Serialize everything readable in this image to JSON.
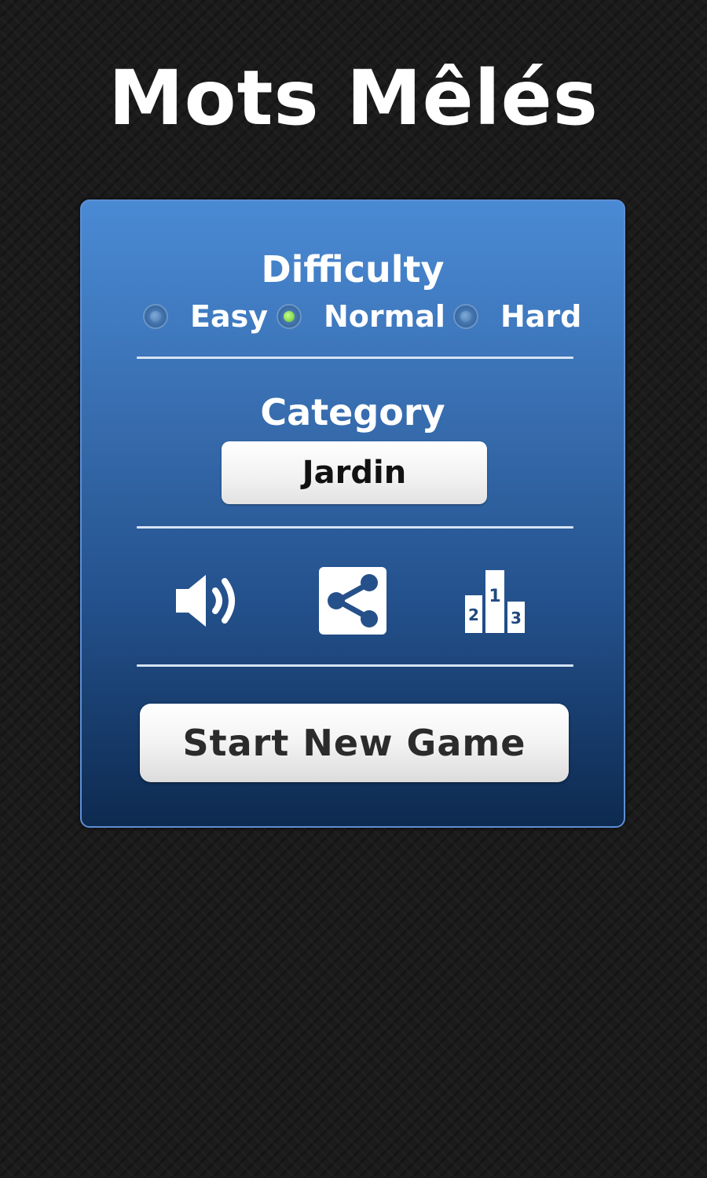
{
  "app": {
    "title": "Mots Mêlés"
  },
  "difficulty": {
    "heading": "Difficulty",
    "options": [
      {
        "label": "Easy",
        "selected": false
      },
      {
        "label": "Normal",
        "selected": true
      },
      {
        "label": "Hard",
        "selected": false
      }
    ]
  },
  "category": {
    "heading": "Category",
    "selected_value": "Jardin"
  },
  "toolbar": {
    "sound_icon": "speaker-volume-icon",
    "share_icon": "share-icon",
    "leaderboard_icon": "podium-leaderboard-icon",
    "podium_places": [
      "2",
      "1",
      "3"
    ]
  },
  "actions": {
    "start_label": "Start New Game"
  },
  "colors": {
    "panel_top": "#4a8ad4",
    "panel_bottom": "#0d2a50",
    "radio_selected": "#5fbf2a",
    "background": "#1b1b1b"
  }
}
